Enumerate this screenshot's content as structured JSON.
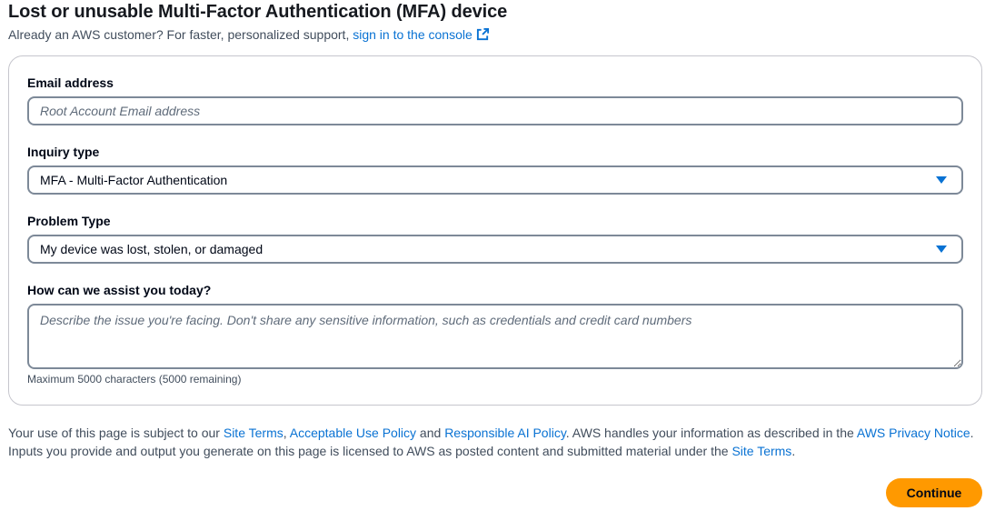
{
  "header": {
    "title": "Lost or unusable Multi-Factor Authentication (MFA) device",
    "subtitle_prefix": "Already an AWS customer? For faster, personalized support, ",
    "signin_link": "sign in to the console"
  },
  "form": {
    "email": {
      "label": "Email address",
      "placeholder": "Root Account Email address",
      "value": ""
    },
    "inquiry": {
      "label": "Inquiry type",
      "value": "MFA - Multi-Factor Authentication"
    },
    "problem": {
      "label": "Problem Type",
      "value": "My device was lost, stolen, or damaged"
    },
    "assist": {
      "label": "How can we assist you today?",
      "placeholder": "Describe the issue you're facing. Don't share any sensitive information, such as credentials and credit card numbers",
      "hint": "Maximum 5000 characters (5000 remaining)"
    }
  },
  "legal": {
    "t1": "Your use of this page is subject to our ",
    "site_terms": "Site Terms",
    "t2": ", ",
    "aup": "Acceptable Use Policy",
    "t3": " and ",
    "rai": "Responsible AI Policy",
    "t4": ". AWS handles your information as described in the ",
    "privacy": "AWS Privacy Notice",
    "t5": ". Inputs you provide and output you generate on this page is licensed to AWS as posted content and submitted material under the ",
    "site_terms_2": "Site Terms",
    "t6": "."
  },
  "actions": {
    "continue_label": "Continue"
  },
  "icons": {
    "signin_link_icon": "external-link-icon",
    "select_caret_icon": "caret-down-icon"
  },
  "colors": {
    "link": "#0972d3",
    "primary_button": "#ff9900",
    "caret": "#0972d3"
  }
}
